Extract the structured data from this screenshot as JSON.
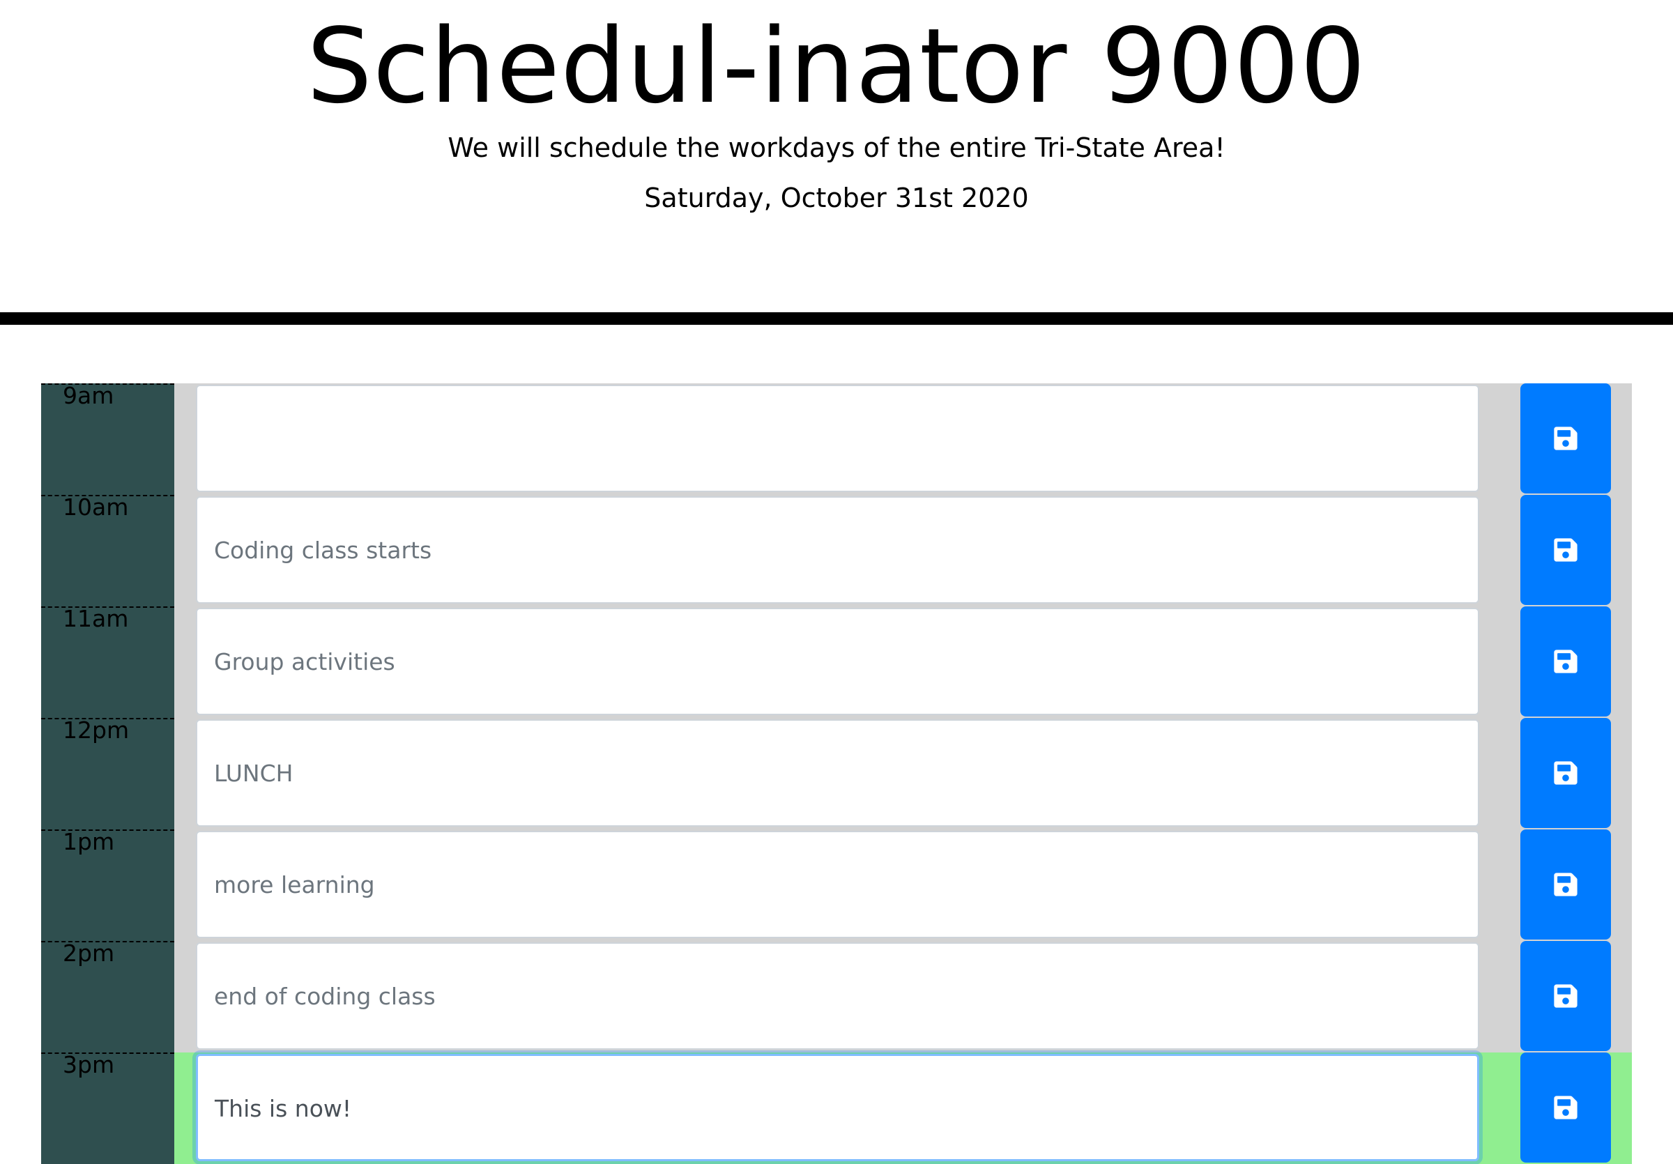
{
  "header": {
    "title": "Schedul-inator 9000",
    "tagline": "We will schedule the workdays of the entire Tri-State Area!",
    "date": "Saturday, October 31st 2020"
  },
  "colors": {
    "hour_column": "#2f4f4f",
    "past_row": "#d3d3d3",
    "present_row": "#90ee90",
    "save_button": "#007bff"
  },
  "icons": {
    "save": "floppy-disk-icon"
  },
  "rows": [
    {
      "hour": "9am",
      "text": "",
      "status": "past"
    },
    {
      "hour": "10am",
      "text": "Coding class starts",
      "status": "past"
    },
    {
      "hour": "11am",
      "text": "Group activities",
      "status": "past"
    },
    {
      "hour": "12pm",
      "text": "LUNCH",
      "status": "past"
    },
    {
      "hour": "1pm",
      "text": "more learning",
      "status": "past"
    },
    {
      "hour": "2pm",
      "text": "end of coding class",
      "status": "past"
    },
    {
      "hour": "3pm",
      "text": "This is now!",
      "status": "present"
    }
  ]
}
